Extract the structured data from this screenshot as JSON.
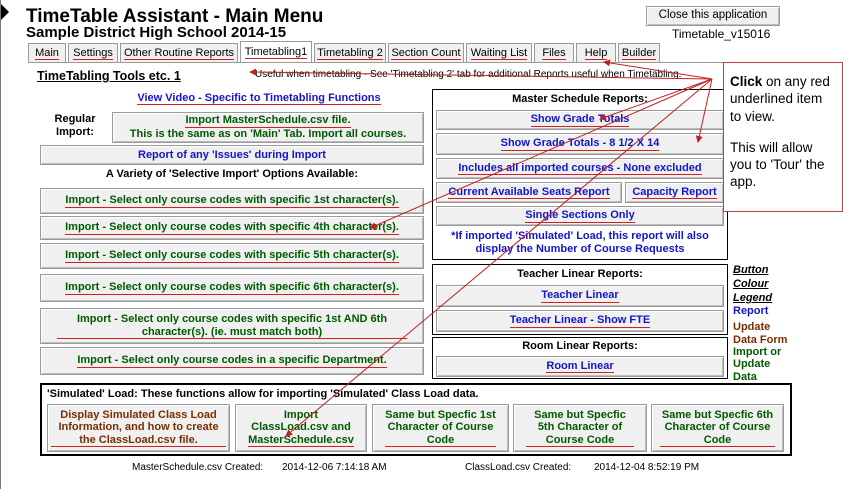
{
  "window": {
    "title": "TimeTable Assistant - Main Menu",
    "school": "Sample District High School 2014-15",
    "version": "Timetable_v15016",
    "close_label": "Close this application"
  },
  "tabs": [
    {
      "label": "Main"
    },
    {
      "label": "Settings"
    },
    {
      "label": "Other Routine Reports"
    },
    {
      "label": "Timetabling1"
    },
    {
      "label": "Timetabling 2"
    },
    {
      "label": "Section Count"
    },
    {
      "label": "Waiting List"
    },
    {
      "label": "Files"
    },
    {
      "label": "Help"
    },
    {
      "label": "Builder"
    }
  ],
  "section_title": "TimeTabling Tools etc. 1",
  "hint": "Useful when timetabling - See 'Timetabling 2' tab for additional Reports useful when Timetabling.",
  "left": {
    "video_label": "View Video - Specific to Timetabling Functions",
    "regular_import_label": "Regular Import:",
    "import_master_line1": "Import MasterSchedule.csv file.",
    "import_master_line2": "This is the same as on 'Main' Tab. Import all courses.",
    "issues_label": "Report of any 'Issues' during Import",
    "selective_heading": "A Variety of 'Selective Import' Options Available:",
    "import_1st": "Import - Select only course codes with specific 1st character(s).",
    "import_4th": "Import - Select only course codes with specific 4th character(s).",
    "import_5th": "Import - Select only course codes with specific 5th character(s).",
    "import_6th": "Import - Select only course codes with specific 6th character(s).",
    "import_1st6th": "Import - Select only course codes with specific 1st AND 6th character(s). (ie. must match both)",
    "import_dept": "Import - Select only course codes in a specific Department."
  },
  "master_reports": {
    "heading": "Master Schedule Reports:",
    "grade_totals": "Show Grade Totals",
    "grade_totals_8": "Show Grade Totals - 8 1/2 X 14",
    "includes_all": "Includes all imported courses - None excluded",
    "seats_report": "Current Available Seats Report",
    "capacity_report": "Capacity Report",
    "single_sections": "Single Sections Only",
    "simulated_note": "*If imported 'Simulated' Load, this report will also display the Number of Course Requests"
  },
  "teacher_reports": {
    "heading": "Teacher Linear Reports:",
    "teacher_linear": "Teacher Linear",
    "teacher_linear_fte": "Teacher Linear - Show FTE"
  },
  "room_reports": {
    "heading": "Room Linear Reports:",
    "room_linear": "Room Linear"
  },
  "legend": {
    "title1": "Button",
    "title2": "Colour",
    "title3": "Legend",
    "report": "Report",
    "update1": "Update",
    "update2": "Data Form",
    "import1": "Import or",
    "import2": "Update",
    "import3": "Data",
    "colors": {
      "report": "#1414c8",
      "update": "#7a2e00",
      "import": "#005a00"
    }
  },
  "note": {
    "click": "Click",
    "line1": " on any red underlined item to view.",
    "line2": "This will allow you to 'Tour' the app."
  },
  "simulated": {
    "heading": "'Simulated' Load: These functions allow for importing 'Simulated' Class Load data.",
    "display_btn": "Display Simulated Class Load Information, and how to create the ClassLoad.csv file.",
    "import_btn": "Import ClassLoad.csv and MasterSchedule.csv",
    "specific_1st": "Same but Specfic 1st Character of Course Code",
    "specific_5th": "Same but Specfic 5th Character of Course Code",
    "specific_6th": "Same but Specfic 6th Character of Course Code"
  },
  "status": {
    "master_label": "MasterSchedule.csv Created:",
    "master_date": "2014-12-06 7:14:18 AM",
    "classload_label": "ClassLoad.csv Created:",
    "classload_date": "2014-12-04 8:52:19 PM"
  }
}
